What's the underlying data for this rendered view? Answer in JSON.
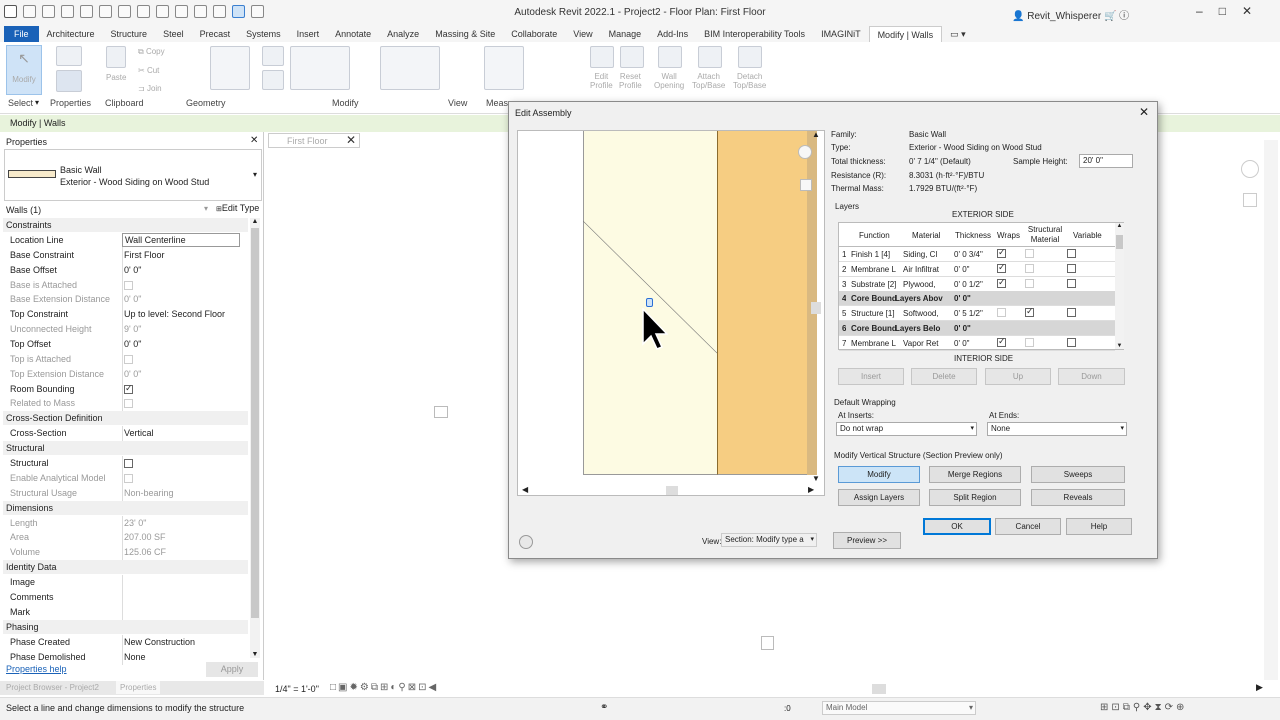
{
  "app": {
    "title": "Autodesk Revit 2022.1 - Project2 - Floor Plan: First Floor",
    "user": "Revit_Whisperer",
    "win_controls": [
      "–",
      "□",
      "✕"
    ]
  },
  "ribbon": {
    "tabs": [
      "File",
      "Architecture",
      "Structure",
      "Steel",
      "Precast",
      "Systems",
      "Insert",
      "Annotate",
      "Analyze",
      "Massing & Site",
      "Collaborate",
      "View",
      "Manage",
      "Add-Ins",
      "BIM Interoperability Tools",
      "IMAGINiT",
      "Modify | Walls"
    ],
    "modify_label": "Modify",
    "paste_label": "Paste",
    "copy_label": "Copy",
    "cut_label": "Cut",
    "join_label": "Join",
    "edit_profile": "Edit\nProfile",
    "reset_profile": "Reset\nProfile",
    "wall_opening": "Wall\nOpening",
    "attach_top": "Attach\nTop/Base",
    "detach_top": "Detach\nTop/Base",
    "groups": [
      "Select",
      "Properties",
      "Clipboard",
      "Geometry",
      "Modify",
      "View",
      "Meas"
    ]
  },
  "context_bar": "Modify | Walls",
  "properties": {
    "header": "Properties",
    "family": "Basic Wall",
    "type": "Exterior - Wood Siding on Wood Stud",
    "selector": "Walls (1)",
    "edit_type": "Edit Type",
    "rows": [
      {
        "kind": "section",
        "label": "Constraints"
      },
      {
        "kind": "row",
        "k": "Location Line",
        "v": "Wall Centerline",
        "dim": false,
        "box": true
      },
      {
        "kind": "row",
        "k": "Base Constraint",
        "v": "First Floor",
        "dim": false
      },
      {
        "kind": "row",
        "k": "Base Offset",
        "v": "0'  0\"",
        "dim": false
      },
      {
        "kind": "row",
        "k": "Base is Attached",
        "v": "",
        "dim": true,
        "cb": "dis"
      },
      {
        "kind": "row",
        "k": "Base Extension Distance",
        "v": "0'  0\"",
        "dim": true
      },
      {
        "kind": "row",
        "k": "Top Constraint",
        "v": "Up to level: Second Floor",
        "dim": false
      },
      {
        "kind": "row",
        "k": "Unconnected Height",
        "v": "9'  0\"",
        "dim": true
      },
      {
        "kind": "row",
        "k": "Top Offset",
        "v": "0'  0\"",
        "dim": false
      },
      {
        "kind": "row",
        "k": "Top is Attached",
        "v": "",
        "dim": true,
        "cb": "dis"
      },
      {
        "kind": "row",
        "k": "Top Extension Distance",
        "v": "0'  0\"",
        "dim": true
      },
      {
        "kind": "row",
        "k": "Room Bounding",
        "v": "",
        "dim": false,
        "cb": "on"
      },
      {
        "kind": "row",
        "k": "Related to Mass",
        "v": "",
        "dim": true,
        "cb": "dis"
      },
      {
        "kind": "section",
        "label": "Cross-Section Definition"
      },
      {
        "kind": "row",
        "k": "Cross-Section",
        "v": "Vertical",
        "dim": false
      },
      {
        "kind": "section",
        "label": "Structural"
      },
      {
        "kind": "row",
        "k": "Structural",
        "v": "",
        "dim": false,
        "cb": "off"
      },
      {
        "kind": "row",
        "k": "Enable Analytical Model",
        "v": "",
        "dim": true,
        "cb": "dis"
      },
      {
        "kind": "row",
        "k": "Structural Usage",
        "v": "Non-bearing",
        "dim": true
      },
      {
        "kind": "section",
        "label": "Dimensions"
      },
      {
        "kind": "row",
        "k": "Length",
        "v": "23'  0\"",
        "dim": true
      },
      {
        "kind": "row",
        "k": "Area",
        "v": "207.00 SF",
        "dim": true
      },
      {
        "kind": "row",
        "k": "Volume",
        "v": "125.06 CF",
        "dim": true
      },
      {
        "kind": "section",
        "label": "Identity Data"
      },
      {
        "kind": "row",
        "k": "Image",
        "v": "",
        "dim": false
      },
      {
        "kind": "row",
        "k": "Comments",
        "v": "",
        "dim": false
      },
      {
        "kind": "row",
        "k": "Mark",
        "v": "",
        "dim": false
      },
      {
        "kind": "section",
        "label": "Phasing"
      },
      {
        "kind": "row",
        "k": "Phase Created",
        "v": "New Construction",
        "dim": false
      },
      {
        "kind": "row",
        "k": "Phase Demolished",
        "v": "None",
        "dim": false
      }
    ],
    "help_link": "Properties help",
    "apply": "Apply",
    "bottom_tabs": [
      "Project Browser - Project2",
      "Properties"
    ]
  },
  "view": {
    "tab_label": "First Floor",
    "scale": "1/4\" = 1'-0\""
  },
  "status": {
    "hint": "Select a line and change dimensions to modify the structure",
    "zero": ":0",
    "model": "Main Model"
  },
  "dialog": {
    "title": "Edit Assembly",
    "family_label": "Family:",
    "family_value": "Basic Wall",
    "type_label": "Type:",
    "type_value": "Exterior - Wood Siding on Wood Stud",
    "thickness_label": "Total thickness:",
    "thickness_value": "0'  7 1/4\" (Default)",
    "sample_height_label": "Sample Height:",
    "sample_height_value": "20'  0\"",
    "resistance_label": "Resistance (R):",
    "resistance_value": "8.3031 (h·ft²·°F)/BTU",
    "mass_label": "Thermal Mass:",
    "mass_value": "1.7929 BTU/(ft²·°F)",
    "layers_label": "Layers",
    "exterior_side": "EXTERIOR SIDE",
    "interior_side": "INTERIOR SIDE",
    "columns": [
      "Function",
      "Material",
      "Thickness",
      "Wraps",
      "Structural Material",
      "Variable"
    ],
    "layers": [
      {
        "n": "1",
        "func": "Finish 1 [4]",
        "mat": "Siding, Cl",
        "thk": "0'  0 3/4\"",
        "wraps": "on",
        "struct": "dis",
        "var": "off",
        "bound": false
      },
      {
        "n": "2",
        "func": "Membrane L",
        "mat": "Air Infiltrat",
        "thk": "0'  0\"",
        "wraps": "on",
        "struct": "dis",
        "var": "off",
        "bound": false
      },
      {
        "n": "3",
        "func": "Substrate [2]",
        "mat": "Plywood,",
        "thk": "0'  0 1/2\"",
        "wraps": "on",
        "struct": "dis",
        "var": "off",
        "bound": false
      },
      {
        "n": "4",
        "func": "Core Bound",
        "mat": "Layers Abov",
        "thk": "0'  0\"",
        "wraps": "",
        "struct": "",
        "var": "",
        "bound": true
      },
      {
        "n": "5",
        "func": "Structure [1]",
        "mat": "Softwood,",
        "thk": "0'  5 1/2\"",
        "wraps": "dis",
        "struct": "on",
        "var": "off",
        "bound": false
      },
      {
        "n": "6",
        "func": "Core Bound",
        "mat": "Layers Belo",
        "thk": "0'  0\"",
        "wraps": "",
        "struct": "",
        "var": "",
        "bound": true
      },
      {
        "n": "7",
        "func": "Membrane L",
        "mat": "Vapor Ret",
        "thk": "0'  0\"",
        "wraps": "on",
        "struct": "dis",
        "var": "off",
        "bound": false
      }
    ],
    "insert": "Insert",
    "delete": "Delete",
    "up": "Up",
    "down": "Down",
    "default_wrapping": "Default Wrapping",
    "at_inserts_label": "At Inserts:",
    "at_inserts_value": "Do not wrap",
    "at_ends_label": "At Ends:",
    "at_ends_value": "None",
    "mvs_label": "Modify Vertical Structure (Section Preview only)",
    "modify": "Modify",
    "merge_regions": "Merge Regions",
    "sweeps": "Sweeps",
    "assign_layers": "Assign Layers",
    "split_region": "Split Region",
    "reveals": "Reveals",
    "ok": "OK",
    "cancel": "Cancel",
    "help": "Help",
    "view_label": "View:",
    "view_value": "Section: Modify type a",
    "preview_btn": "Preview >>"
  },
  "colors": {
    "file_tab": "#1a62b8",
    "context_bar": "#e8f3dc",
    "layer_light": "#fdfbe3",
    "layer_orange": "#f6cd82",
    "layer_edge": "#d9b981"
  }
}
